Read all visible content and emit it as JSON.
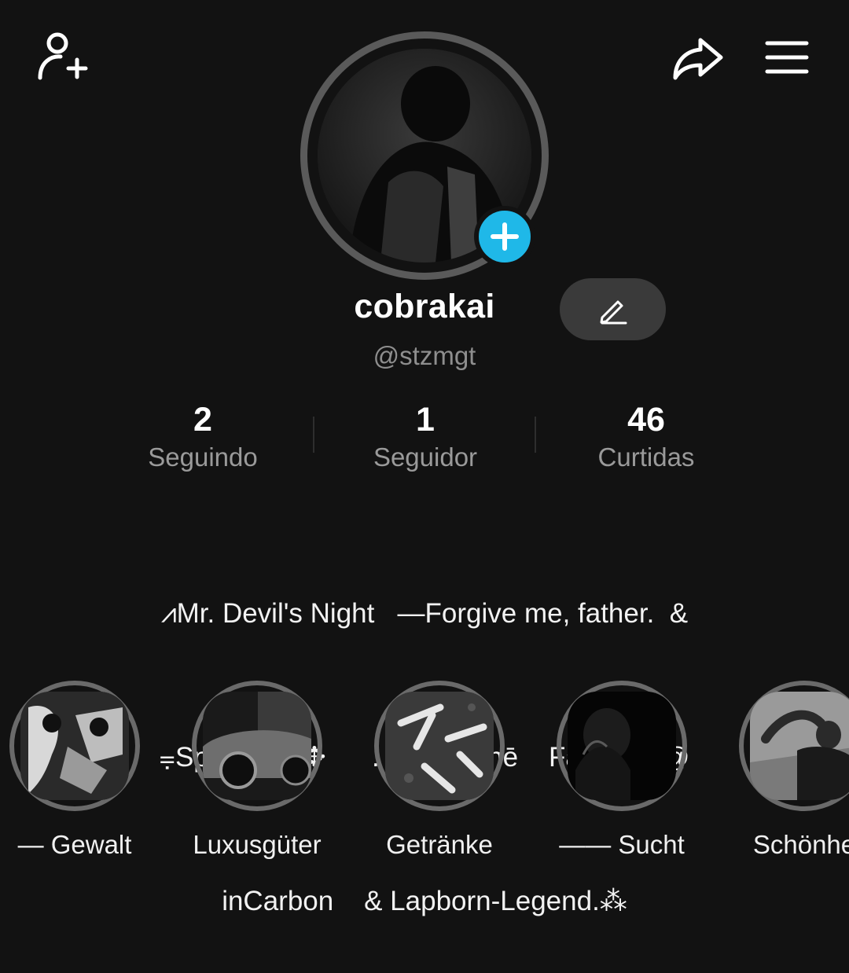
{
  "header": {
    "add_friend_icon": "add-person-icon",
    "share_icon": "share-arrow-icon",
    "menu_icon": "hamburger-menu-icon"
  },
  "profile": {
    "username": "cobrakai",
    "handle": "@stzmgt",
    "edit_icon": "pencil-icon",
    "add_icon": "plus-icon",
    "accent_color": "#1fb8e8"
  },
  "stats": [
    {
      "value": "2",
      "label": "Seguindo"
    },
    {
      "value": "1",
      "label": "Seguidor"
    },
    {
      "value": "46",
      "label": "Curtidas"
    }
  ],
  "bio": {
    "line1": "⩘Mr. Devil's Night   —Forgive me, father.  &",
    "line2": "⩦Speed'.⁂ ✥      .   $$     Thē    Falcon    @",
    "line3": "inCarbon    & Lapborn-Legend.⁂"
  },
  "highlights": [
    {
      "label": "— Gewalt"
    },
    {
      "label": "Luxusgüter"
    },
    {
      "label": "Getränke"
    },
    {
      "label": "—— Sucht"
    },
    {
      "label": "Schönhe"
    }
  ]
}
